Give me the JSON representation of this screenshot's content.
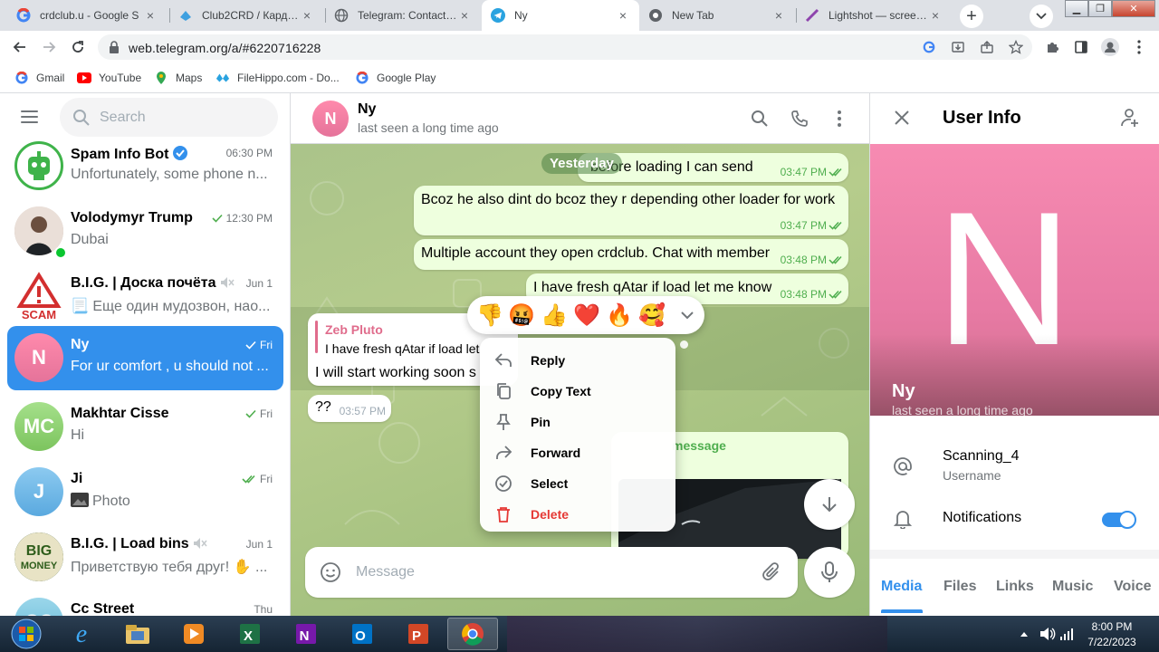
{
  "browser": {
    "tabs": [
      {
        "title": "crdclub.u - Google S",
        "icon": "google-icon"
      },
      {
        "title": "Club2CRD / Кардинг",
        "icon": "club-icon"
      },
      {
        "title": "Telegram: Contact @",
        "icon": "globe-icon"
      },
      {
        "title": "Ny",
        "icon": "telegram-icon",
        "active": true
      },
      {
        "title": "New Tab",
        "icon": "chrome-icon"
      },
      {
        "title": "Lightshot — screensh",
        "icon": "lightshot-icon"
      }
    ],
    "url": "web.telegram.org/a/#6220716228",
    "bookmarks": [
      {
        "label": "Gmail",
        "icon": "google-icon"
      },
      {
        "label": "YouTube",
        "icon": "youtube-icon"
      },
      {
        "label": "Maps",
        "icon": "maps-icon"
      },
      {
        "label": "FileHippo.com - Do...",
        "icon": "filehippo-icon"
      },
      {
        "label": "Google Play",
        "icon": "google-icon"
      }
    ]
  },
  "sidebar": {
    "search_placeholder": "Search",
    "chats": [
      {
        "name": "Spam Info Bot",
        "preview": "Unfortunately, some phone n...",
        "time": "06:30 PM",
        "verified": true,
        "avatar_color": "#ffffff"
      },
      {
        "name": "Volodymyr Trump",
        "preview": "Dubai",
        "time": "12:30 PM",
        "check": "single",
        "online": true
      },
      {
        "name": "B.I.G. | Доска почёта",
        "preview": "📃 Еще один мудозвон, нао...",
        "time": "Jun 1",
        "muted": true
      },
      {
        "name": "Ny",
        "preview": "For ur comfort , u should not ...",
        "time": "Fri",
        "check": "single",
        "selected": true,
        "initials": "N",
        "avatar_color": "#f06f95"
      },
      {
        "name": "Makhtar Cisse",
        "preview": "Hi",
        "time": "Fri",
        "check": "single",
        "initials": "MC",
        "avatar_color": "#8bd06a"
      },
      {
        "name": "Ji",
        "preview": "Photo",
        "time": "Fri",
        "check": "double",
        "initials": "J",
        "avatar_color": "#6ab6e6"
      },
      {
        "name": "B.I.G. | Load bins",
        "preview": "Приветствую тебя друг! ✋ ...",
        "time": "Jun 1",
        "muted": true
      },
      {
        "name": "Cc Street",
        "preview": "",
        "time": "Thu",
        "initials": "CC",
        "avatar_color": "#76c5e0"
      }
    ]
  },
  "chat": {
    "peer_name": "Ny",
    "peer_initial": "N",
    "peer_status": "last seen a long time ago",
    "date_chip": "Yesterday",
    "messages": [
      {
        "text": "before loading I can send",
        "time": "03:47 PM"
      },
      {
        "text": "Bcoz he also dint do bcoz they r depending other loader for work",
        "time": "03:47 PM"
      },
      {
        "text": "Multiple account they open crdclub. Chat with member",
        "time": "03:48 PM"
      },
      {
        "text": "I have fresh qAtar if load let me know",
        "time": "03:48 PM"
      }
    ],
    "reply_message": {
      "quoted_author": "Zeb Pluto",
      "quoted_text": "I have fresh qAtar if load let",
      "text": "I will start working soon s"
    },
    "short_message": {
      "text": "??",
      "time": "03:57 PM"
    },
    "forward_fragment": "message",
    "reactions": [
      "👎",
      "🤬",
      "👍",
      "❤️",
      "🔥",
      "🥰"
    ],
    "context_menu": [
      {
        "label": "Reply",
        "icon": "reply-icon"
      },
      {
        "label": "Copy Text",
        "icon": "copy-icon"
      },
      {
        "label": "Pin",
        "icon": "pin-icon"
      },
      {
        "label": "Forward",
        "icon": "forward-icon"
      },
      {
        "label": "Select",
        "icon": "select-icon"
      },
      {
        "label": "Delete",
        "icon": "delete-icon",
        "danger": true
      }
    ],
    "composer_placeholder": "Message"
  },
  "user_info": {
    "title": "User Info",
    "initial": "N",
    "name": "Ny",
    "status": "last seen a long time ago",
    "username": "Scanning_4",
    "username_label": "Username",
    "notifications_label": "Notifications",
    "notifications_on": true,
    "tabs": [
      "Media",
      "Files",
      "Links",
      "Music",
      "Voice"
    ],
    "active_tab": "Media"
  },
  "taskbar": {
    "apps": [
      "internet-explorer",
      "file-explorer",
      "media-player",
      "excel",
      "onenote",
      "outlook",
      "powerpoint",
      "chrome"
    ],
    "time": "8:00 PM",
    "date": "7/22/2023"
  },
  "colors": {
    "accent": "#3390ec",
    "outgoing_bubble": "#eeffde",
    "check_green": "#4fae4e",
    "danger": "#e53935",
    "tab_strip": "#dee1e6"
  }
}
